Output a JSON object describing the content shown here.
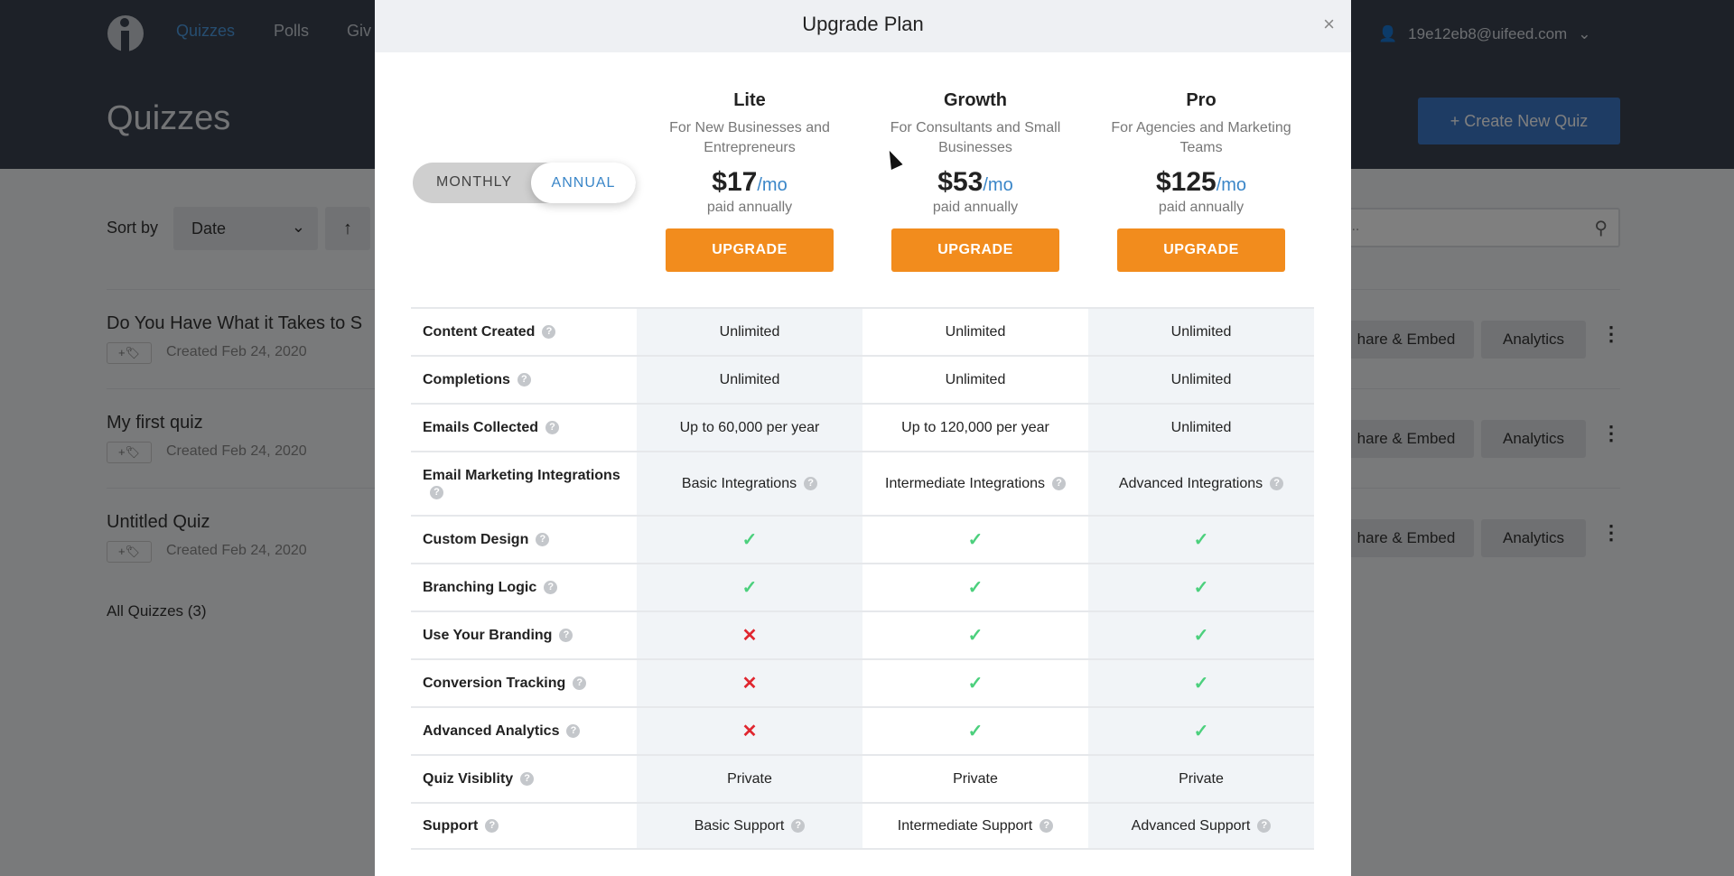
{
  "app": {
    "nav": [
      "Quizzes",
      "Polls",
      "Giv"
    ],
    "page_title": "Quizzes",
    "user_email": "19e12eb8@uifeed.com",
    "create_label": "+ Create New Quiz",
    "sort_label": "Sort by",
    "sort_value": "Date",
    "sort_dir": "↑",
    "search_placeholder": "...",
    "quizzes": [
      {
        "title": "Do You Have What it Takes to S",
        "tag": "+🏷",
        "date": "Created Feb 24, 2020"
      },
      {
        "title": "My first quiz",
        "tag": "+🏷",
        "date": "Created Feb 24, 2020"
      },
      {
        "title": "Untitled Quiz",
        "tag": "+🏷",
        "date": "Created Feb 24, 2020"
      }
    ],
    "share_label": "hare & Embed",
    "analytics_label": "Analytics",
    "all_quizzes": "All Quizzes (3)"
  },
  "modal": {
    "title": "Upgrade Plan",
    "close": "×",
    "toggle": {
      "monthly": "MONTHLY",
      "annual": "ANNUAL",
      "selected": "annual"
    },
    "plans": [
      {
        "name": "Lite",
        "desc": "For New Businesses and Entrepreneurs",
        "price": "$17",
        "per": "/mo",
        "billing": "paid annually",
        "button": "UPGRADE"
      },
      {
        "name": "Growth",
        "desc": "For Consultants and Small Businesses",
        "price": "$53",
        "per": "/mo",
        "billing": "paid annually",
        "button": "UPGRADE"
      },
      {
        "name": "Pro",
        "desc": "For Agencies and Marketing Teams",
        "price": "$125",
        "per": "/mo",
        "billing": "paid annually",
        "button": "UPGRADE"
      }
    ],
    "features": [
      {
        "label": "Content Created",
        "values": [
          "Unlimited",
          "Unlimited",
          "Unlimited"
        ]
      },
      {
        "label": "Completions",
        "values": [
          "Unlimited",
          "Unlimited",
          "Unlimited"
        ]
      },
      {
        "label": "Emails Collected",
        "values": [
          "Up to 60,000 per year",
          "Up to 120,000 per year",
          "Unlimited"
        ]
      },
      {
        "label": "Email Marketing Integrations",
        "values": [
          "Basic Integrations",
          "Intermediate Integrations",
          "Advanced Integrations"
        ],
        "help_values": true
      },
      {
        "label": "Custom Design",
        "values": [
          "check",
          "check",
          "check"
        ]
      },
      {
        "label": "Branching Logic",
        "values": [
          "check",
          "check",
          "check"
        ]
      },
      {
        "label": "Use Your Branding",
        "values": [
          "cross",
          "check",
          "check"
        ]
      },
      {
        "label": "Conversion Tracking",
        "values": [
          "cross",
          "check",
          "check"
        ]
      },
      {
        "label": "Advanced Analytics",
        "values": [
          "cross",
          "check",
          "check"
        ]
      },
      {
        "label": "Quiz Visiblity",
        "values": [
          "Private",
          "Private",
          "Private"
        ]
      },
      {
        "label": "Support",
        "values": [
          "Basic Support",
          "Intermediate Support",
          "Advanced Support"
        ],
        "help_values": true
      }
    ]
  },
  "colors": {
    "accent": "#f28c1d",
    "blue": "#3a86c8",
    "check": "#4cd07d",
    "cross": "#e0262f"
  }
}
